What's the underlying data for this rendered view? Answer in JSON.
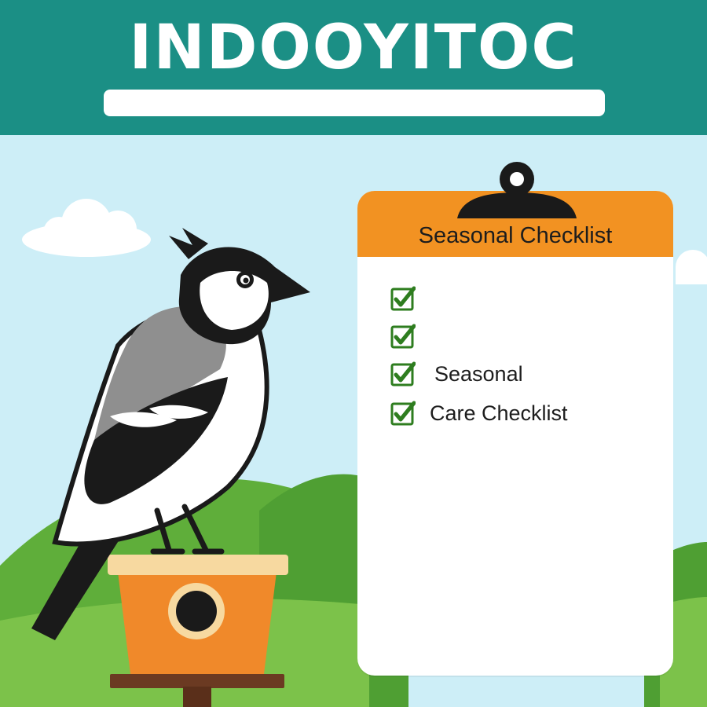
{
  "banner": {
    "title": "INDOOYITOC"
  },
  "checklist": {
    "title": "Seasonal Checklist",
    "items": [
      {
        "label": ""
      },
      {
        "label": ""
      },
      {
        "label": "Seasonal"
      },
      {
        "label": "Care Checklist"
      }
    ]
  },
  "colors": {
    "banner": "#1b8f85",
    "sky": "#cdeef7",
    "grass": "#7cc24a",
    "clipboard_header": "#f29222",
    "check": "#2e7d1f",
    "feeder": "#f0892a"
  },
  "icons": [
    "clipboard-clip-icon",
    "checkbox-icon",
    "bird-illustration",
    "bird-feeder-illustration"
  ]
}
